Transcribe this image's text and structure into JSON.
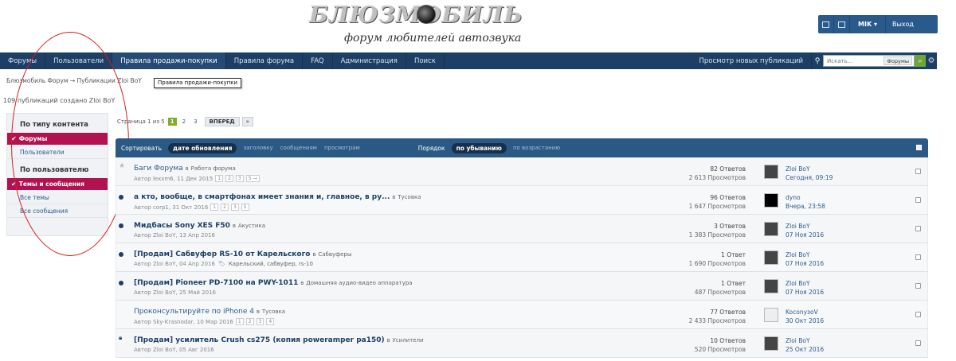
{
  "logo": {
    "title": "БЛЮЗМОБИЛЬ",
    "subtitle": "форум любителей автозвука"
  },
  "userbar": {
    "username": "MIK",
    "exit": "Выход"
  },
  "nav": {
    "items": [
      "Форумы",
      "Пользователи",
      "Правила продажи-покупки",
      "Правила форума",
      "FAQ",
      "Администрация",
      "Поиск"
    ],
    "new_posts": "Просмотр новых публикаций",
    "search_placeholder": "Искать...",
    "search_scope": "Форумы"
  },
  "breadcrumb": "Блюзмобиль Форум  →  Публикации Zloi BoY",
  "tooltip": "Правила продажи-покупки",
  "pub_count": "109 публикаций создано Zloi BoY",
  "sidebar": {
    "head1": "По типу контента",
    "sel1": "Форумы",
    "link1": "Пользователи",
    "head2": "По пользователю",
    "sel2": "Темы и сообщения",
    "link2": "Все темы",
    "link3": "Все сообщения"
  },
  "pager": {
    "label": "Страница 1 из 5",
    "pages": [
      "1",
      "2",
      "3"
    ],
    "next": "ВПЕРЕД",
    "arrow": "»"
  },
  "sortbar": {
    "sort_label": "Сортировать",
    "sort_active": "дате обновления",
    "sort_opts": [
      "заголовку",
      "сообщениям",
      "просмотрам"
    ],
    "order_label": "Порядок",
    "order_active": "по убыванию",
    "order_opt": "по возрастанию"
  },
  "topics": [
    {
      "title": "Баги Форума",
      "unread": false,
      "icon": "star",
      "in": "в",
      "forum": "Работа форума",
      "meta": "Автор lexxm6, 11 Дек 2015",
      "pages": [
        "1",
        "2",
        "3",
        "5 →"
      ],
      "tags": "",
      "replies": "82 Ответов",
      "views": "2 613 Просмотров",
      "last_user": "Zloi BoY",
      "last_date": "Сегодня, 09:19",
      "avatar": "gray"
    },
    {
      "title": "а кто, вообще, в смартфонах имеет знания и, главное, в ру...",
      "unread": true,
      "icon": "dot",
      "in": "в",
      "forum": "Тусовка",
      "meta": "Автор corp1, 31 Окт 2016",
      "pages": [
        "1",
        "2",
        "3",
        "5"
      ],
      "tags": "",
      "replies": "96 Ответов",
      "views": "1 647 Просмотров",
      "last_user": "dyno",
      "last_date": "Вчера, 23:58",
      "avatar": "black"
    },
    {
      "title": "Мидбасы Sony XES F50",
      "unread": true,
      "icon": "dot",
      "in": "в",
      "forum": "Акустика",
      "meta": "Автор Zloi BoY, 13 Апр 2016",
      "pages": [],
      "tags": "",
      "replies": "3 Ответов",
      "views": "1 383 Просмотров",
      "last_user": "Zloi BoY",
      "last_date": "07 Ноя 2016",
      "avatar": "gray"
    },
    {
      "title": "[Продам] Сабвуфер RS-10 от Карельского",
      "unread": true,
      "icon": "dot",
      "in": "в",
      "forum": "Сабвуферы",
      "meta": "Автор Zloi BoY, 04 Апр 2016",
      "pages": [],
      "tags": "Карельский, сабвуфер, rs-10",
      "replies": "1 Ответ",
      "views": "1 690 Просмотров",
      "last_user": "Zloi BoY",
      "last_date": "07 Ноя 2016",
      "avatar": "gray"
    },
    {
      "title": "[Продам] Pioneer PD-7100 на PWY-1011",
      "unread": true,
      "icon": "dot",
      "in": "в",
      "forum": "Домашняя аудио-видео аппаратура",
      "meta": "Автор Zloi BoY, 25 Май 2016",
      "pages": [],
      "tags": "",
      "replies": "1 Ответ",
      "views": "487 Просмотров",
      "last_user": "Zloi BoY",
      "last_date": "07 Ноя 2016",
      "avatar": "gray"
    },
    {
      "title": "Проконсультируйте по iPhone 4",
      "unread": false,
      "icon": "none",
      "in": "в",
      "forum": "Тусовка",
      "meta": "Автор Sky-Krasnodar, 10 Мар 2016",
      "pages": [
        "1",
        "2",
        "3",
        "4"
      ],
      "tags": "",
      "replies": "77 Ответов",
      "views": "2 433 Просмотров",
      "last_user": "KoconyзoV",
      "last_date": "30 Окт 2016",
      "avatar": "white"
    },
    {
      "title": "[Продам] усилитель Crush cs275 (копия powerampеr pa150)",
      "unread": true,
      "icon": "lock",
      "in": "в",
      "forum": "Усилители",
      "meta": "Автор Zloi BoY, 05 Авг 2016",
      "pages": [],
      "tags": "",
      "replies": "10 Ответов",
      "views": "520 Просмотров",
      "last_user": "Zloi BoY",
      "last_date": "25 Окт 2016",
      "avatar": "gray"
    }
  ]
}
